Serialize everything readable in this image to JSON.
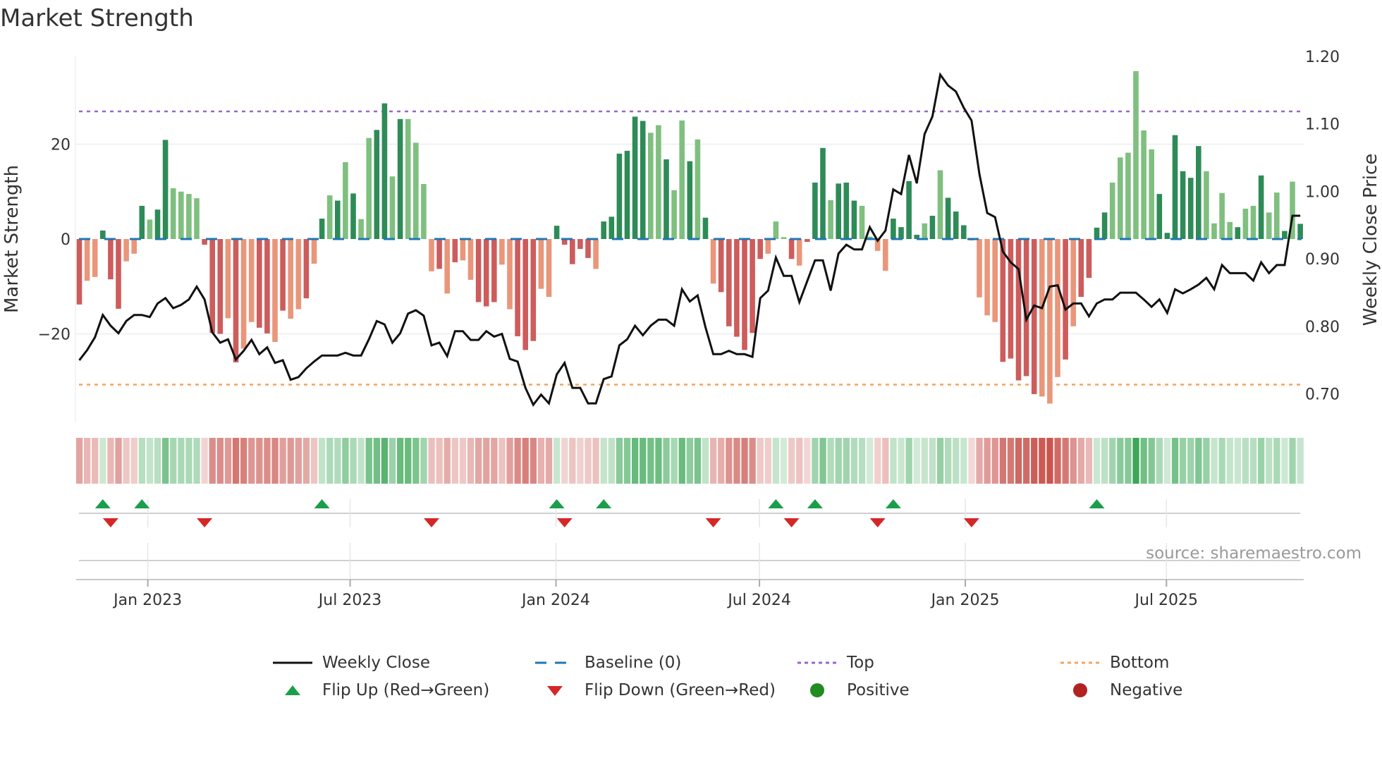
{
  "title": "Market Strength",
  "source": "source: sharemaestro.com",
  "colors": {
    "pos_dark": "#2e8b57",
    "pos_light": "#7fbf7f",
    "neg_dark": "#cd5c5c",
    "neg_light": "#e9967a",
    "line": "#111111",
    "baseline": "#1f77b4",
    "top": "#9966cc",
    "bottom": "#f4a460",
    "flip_up": "#1a9e4a",
    "flip_down": "#d62728",
    "positive": "#228b22",
    "negative": "#b22222",
    "strip_pos": "#3aa655",
    "strip_neg": "#c8504a"
  },
  "chart_data": {
    "type": "bar+line",
    "title": "Market Strength",
    "ylabel": "Market Strength",
    "y2label": "Weekly Close Price",
    "ylim": [
      -38.5,
      38.5
    ],
    "y2lim": [
      0.659,
      1.2
    ],
    "yticks": [
      {
        "value": 20,
        "label": "20"
      },
      {
        "value": 0,
        "label": "0"
      },
      {
        "value": -20,
        "label": "−20"
      }
    ],
    "y2ticks": [
      {
        "value": 1.2,
        "label": "1.20"
      },
      {
        "value": 1.1,
        "label": "1.10"
      },
      {
        "value": 1.0,
        "label": "1.00"
      },
      {
        "value": 0.9,
        "label": "0.90"
      },
      {
        "value": 0.8,
        "label": "0.80"
      },
      {
        "value": 0.7,
        "label": "0.70"
      }
    ],
    "xticks": [
      {
        "week": 8.75,
        "label": "Jan 2023"
      },
      {
        "week": 34.6,
        "label": "Jul 2023"
      },
      {
        "week": 60.9,
        "label": "Jan 2024"
      },
      {
        "week": 86.9,
        "label": "Jul 2024"
      },
      {
        "week": 113.2,
        "label": "Jan 2025"
      },
      {
        "week": 138.9,
        "label": "Jul 2025"
      }
    ],
    "top_level": 26.9,
    "bottom_level": -30.7,
    "baseline": 0,
    "strength": [
      -13.8,
      -8.8,
      -8,
      1.8,
      -8.5,
      -14.7,
      -4.7,
      -3.1,
      7,
      4.1,
      6.2,
      20.9,
      10.7,
      10,
      9.5,
      8.6,
      -1.2,
      -19.8,
      -20,
      -16.7,
      -26,
      -23.1,
      -17.5,
      -18.7,
      -19.9,
      -21.7,
      -15.1,
      -16.8,
      -14.8,
      -12.5,
      -5.2,
      4.3,
      9.2,
      8.1,
      16.2,
      9.6,
      4.2,
      21.3,
      23,
      28.6,
      13.2,
      25.3,
      25.3,
      20.3,
      11.6,
      -6.8,
      -6.3,
      -11.5,
      -4.9,
      -4.5,
      -8.6,
      -13.3,
      -14.2,
      -13.3,
      -5.4,
      -14.8,
      -20.5,
      -23.4,
      -21.5,
      -10.5,
      -12.2,
      2.8,
      -1.2,
      -5.3,
      -2.1,
      -4,
      -6.3,
      3.7,
      4.7,
      18,
      18.6,
      25.8,
      24.9,
      22.4,
      24,
      16.8,
      10.3,
      25,
      16.4,
      21,
      4.5,
      -9.4,
      -11.2,
      -18.4,
      -20.6,
      -23.4,
      -19.8,
      -4.2,
      -3.1,
      3.7,
      0.4,
      -4.2,
      -5.6,
      -0.6,
      11.9,
      19.2,
      8.2,
      11.7,
      11.9,
      8.1,
      7,
      0.5,
      -2.5,
      -6.7,
      4.3,
      2.5,
      12.2,
      0.9,
      3.3,
      4.9,
      14.5,
      8.7,
      5.8,
      2.9,
      -0.3,
      -12.3,
      -16.1,
      -17.5,
      -25.9,
      -25.2,
      -29.8,
      -28.9,
      -32.7,
      -33.2,
      -34.7,
      -29.1,
      -25.4,
      -18.4,
      -12.2,
      -8.2,
      2.4,
      5.6,
      11.9,
      17.2,
      18.2,
      35.4,
      22.9,
      18.9,
      9.5,
      1.3,
      21.9,
      14.3,
      12.9,
      19.6,
      14.3,
      3.3,
      9.7,
      3.6,
      2.5,
      6.4,
      7,
      13.4,
      5.6,
      9.8,
      1.7,
      12.1,
      3.2
    ],
    "shade": "dlldddlldlddlllldddldllddldlldldldldllddldlllldldlldddlldddlldddddlddddddlldlldldlddddddllldldddldddllllddddldldddlllldddddllldlddddllllllddddddlllldlldlldldddldldl",
    "weekly_close": [
      0.75,
      0.765,
      0.784,
      0.817,
      0.801,
      0.79,
      0.808,
      0.817,
      0.817,
      0.814,
      0.834,
      0.842,
      0.827,
      0.832,
      0.84,
      0.859,
      0.84,
      0.791,
      0.776,
      0.781,
      0.751,
      0.764,
      0.78,
      0.759,
      0.769,
      0.746,
      0.75,
      0.721,
      0.725,
      0.738,
      0.748,
      0.757,
      0.757,
      0.757,
      0.761,
      0.757,
      0.757,
      0.781,
      0.808,
      0.803,
      0.776,
      0.79,
      0.819,
      0.824,
      0.816,
      0.772,
      0.776,
      0.756,
      0.793,
      0.793,
      0.78,
      0.78,
      0.793,
      0.785,
      0.789,
      0.752,
      0.748,
      0.709,
      0.684,
      0.699,
      0.686,
      0.729,
      0.746,
      0.709,
      0.709,
      0.686,
      0.686,
      0.722,
      0.726,
      0.772,
      0.781,
      0.801,
      0.787,
      0.801,
      0.81,
      0.81,
      0.801,
      0.855,
      0.837,
      0.846,
      0.799,
      0.759,
      0.759,
      0.764,
      0.759,
      0.759,
      0.755,
      0.842,
      0.853,
      0.902,
      0.875,
      0.875,
      0.836,
      0.867,
      0.898,
      0.898,
      0.853,
      0.908,
      0.921,
      0.914,
      0.914,
      0.947,
      0.927,
      0.942,
      1.003,
      0.996,
      1.054,
      1.012,
      1.085,
      1.111,
      1.173,
      1.157,
      1.148,
      1.124,
      1.105,
      1.026,
      0.968,
      0.962,
      0.911,
      0.895,
      0.885,
      0.81,
      0.831,
      0.827,
      0.859,
      0.861,
      0.825,
      0.834,
      0.834,
      0.815,
      0.834,
      0.84,
      0.84,
      0.85,
      0.85,
      0.85,
      0.84,
      0.829,
      0.84,
      0.82,
      0.855,
      0.849,
      0.855,
      0.862,
      0.872,
      0.855,
      0.891,
      0.879,
      0.879,
      0.879,
      0.868,
      0.895,
      0.879,
      0.891,
      0.891,
      0.964,
      0.964
    ],
    "flip_up_weeks": [
      4,
      9,
      32,
      62,
      68,
      90,
      95,
      105,
      131
    ],
    "flip_down_weeks": [
      5,
      17,
      46,
      63,
      82,
      92,
      103,
      115
    ],
    "grid": true,
    "legend_position": "bottom-center"
  },
  "legend": {
    "weekly_close": "Weekly Close",
    "baseline": "Baseline (0)",
    "top": "Top",
    "bottom": "Bottom",
    "flip_up": "Flip Up (Red→Green)",
    "flip_down": "Flip Down (Green→Red)",
    "positive": "Positive",
    "negative": "Negative"
  }
}
